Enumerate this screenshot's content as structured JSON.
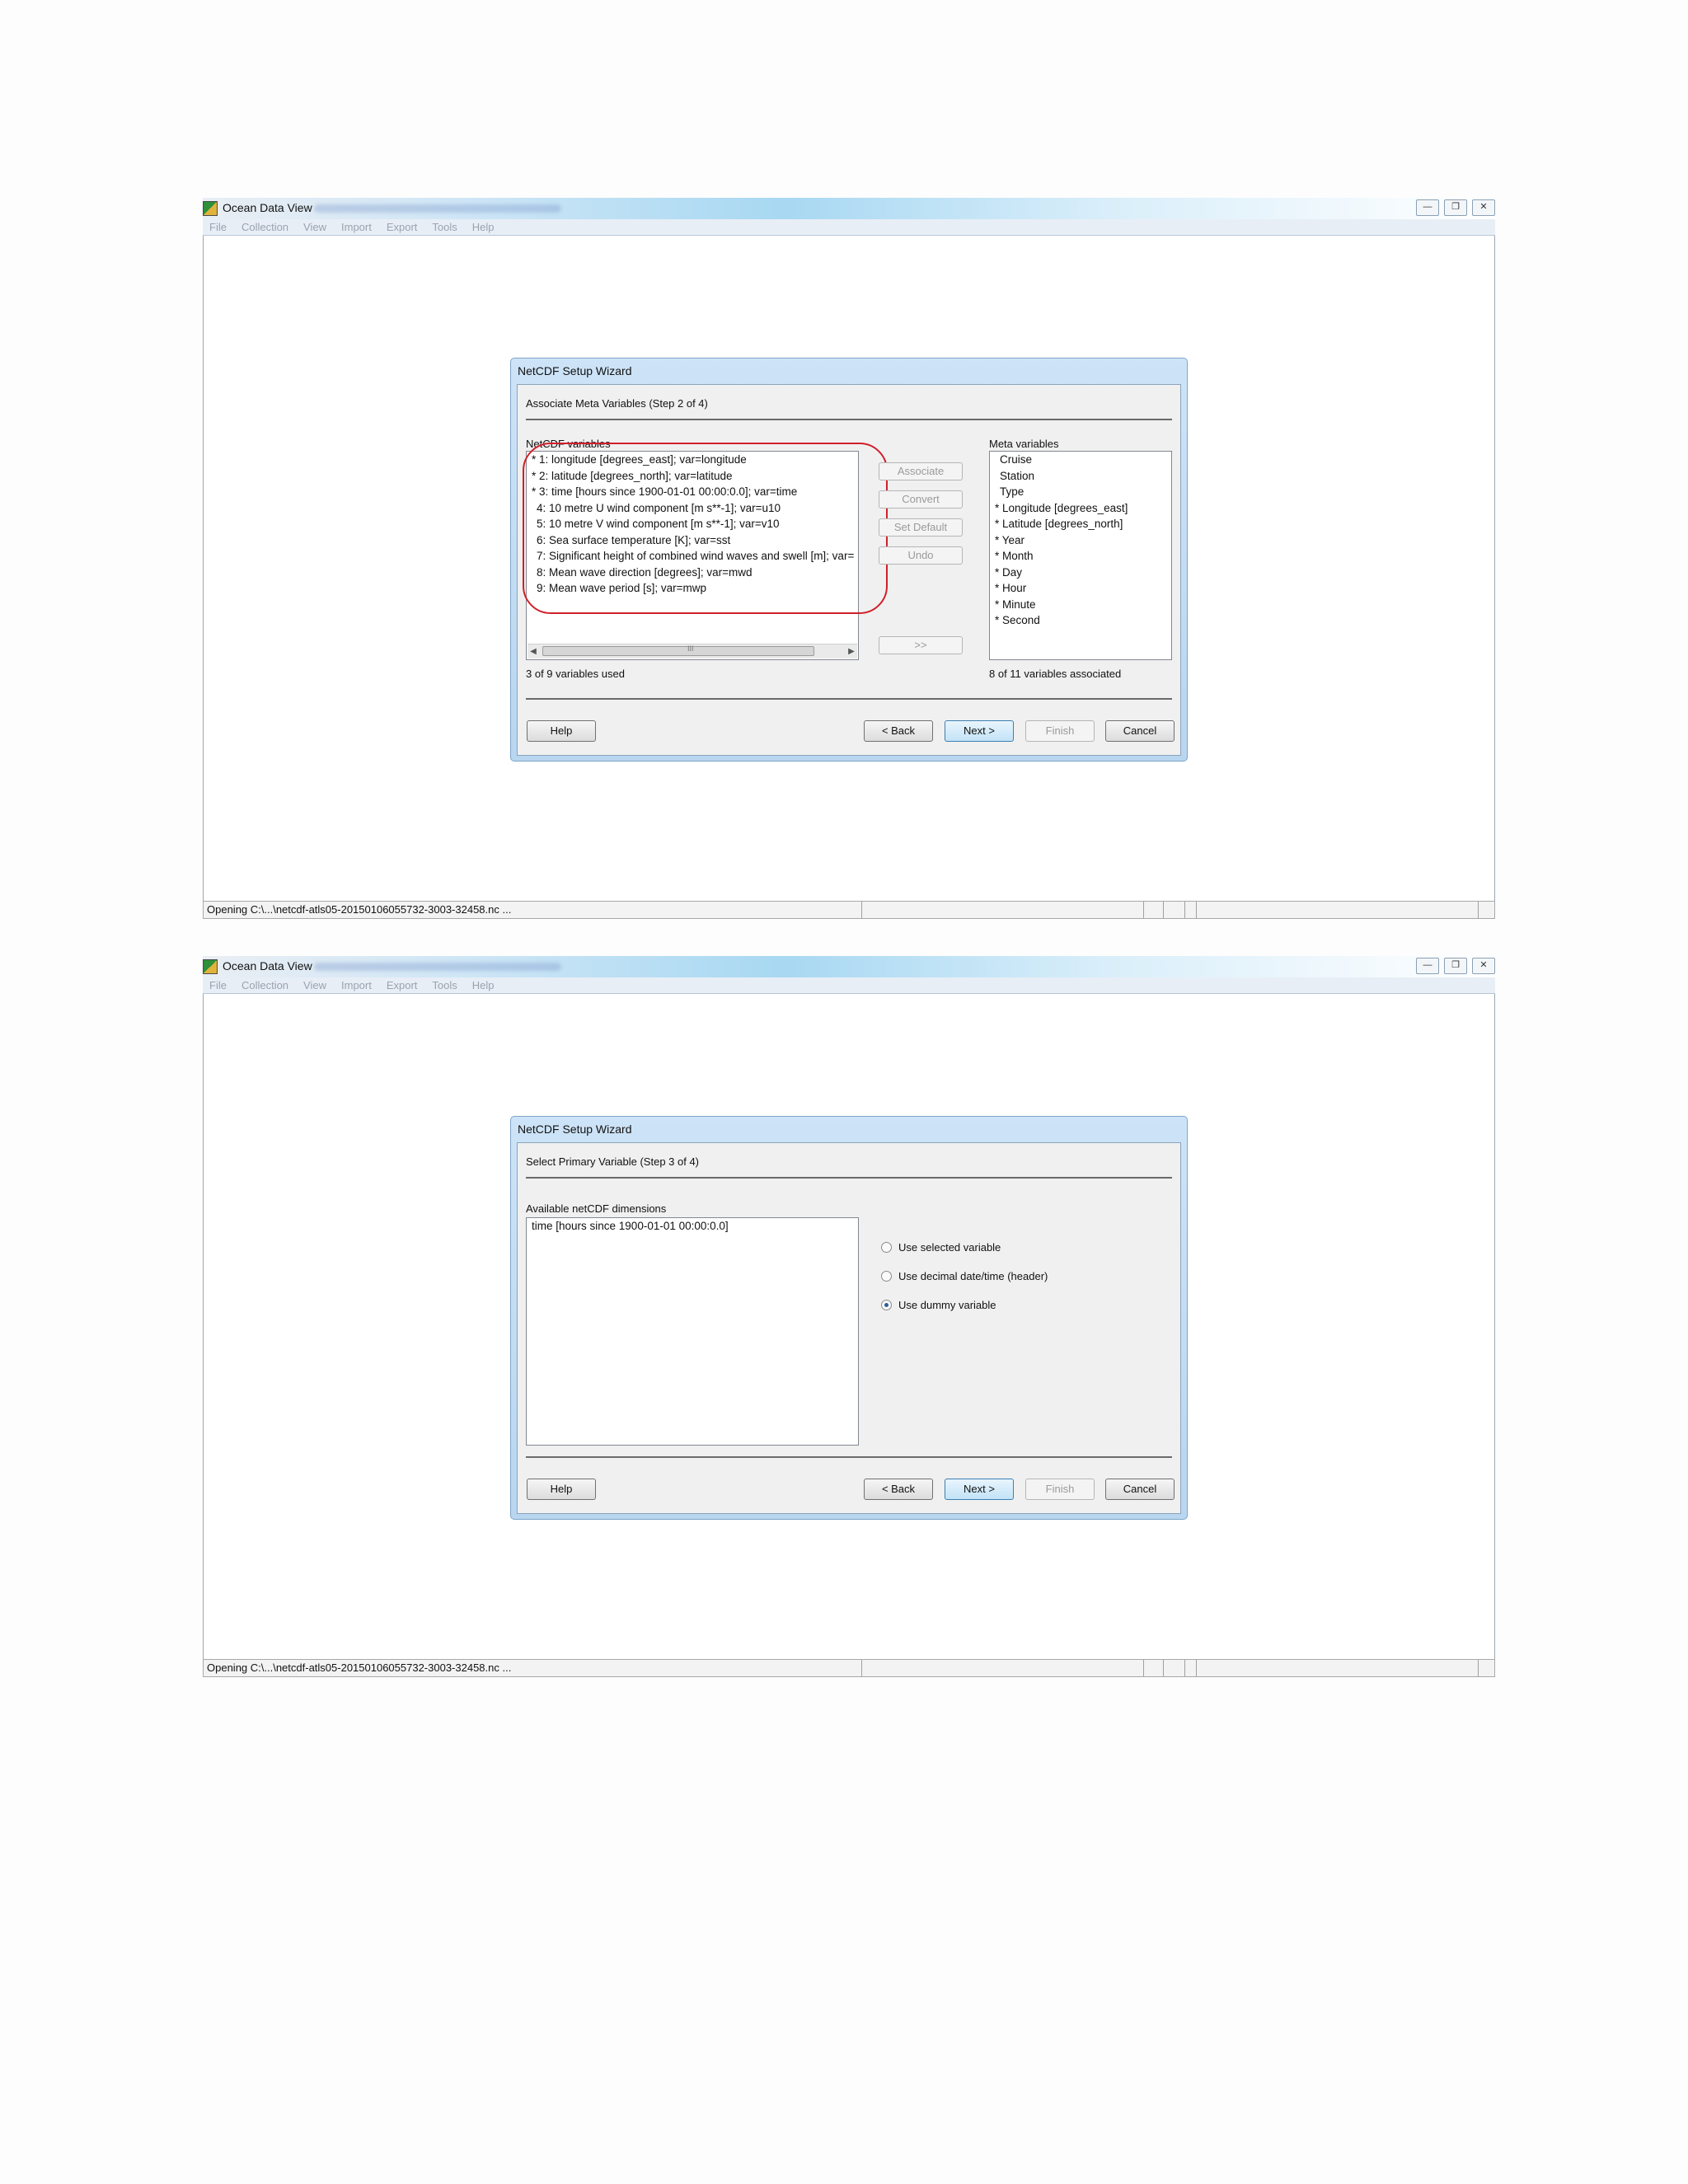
{
  "colors": {
    "highlight": "#d0202a",
    "accent": "#3c7fb1",
    "dialog_frame": "#b9d6f0"
  },
  "window_common": {
    "app_title": "Ocean Data View",
    "menu": [
      "File",
      "Collection",
      "View",
      "Import",
      "Export",
      "Tools",
      "Help"
    ],
    "status_text": "Opening C:\\...\\netcdf-atls05-20150106055732-3003-32458.nc ...",
    "icons": [
      "app-icon",
      "minimize-icon",
      "restore-icon",
      "close-icon"
    ]
  },
  "dialog1": {
    "title": "NetCDF Setup Wizard",
    "step": "Associate Meta Variables (Step 2 of 4)",
    "netcdf_label": "NetCDF variables",
    "netcdf_items": [
      "* 1: longitude [degrees_east]; var=longitude",
      "* 2: latitude [degrees_north]; var=latitude",
      "* 3: time [hours since 1900-01-01 00:00:0.0]; var=time",
      "4: 10 metre U wind component [m s**-1]; var=u10",
      "5: 10 metre V wind component [m s**-1]; var=v10",
      "6: Sea surface temperature [K]; var=sst",
      "7: Significant height of combined wind waves and swell [m]; var=",
      "8: Mean wave direction [degrees]; var=mwd",
      "9: Mean wave period [s]; var=mwp"
    ],
    "scroll_thumb_glyph": "III",
    "used_count": "3 of 9 variables used",
    "middle_buttons": [
      "Associate",
      "Convert",
      "Set Default",
      "Undo"
    ],
    "arrow_button": ">>",
    "meta_label": "Meta variables",
    "meta_items": [
      "Cruise",
      "Station",
      "Type",
      "* Longitude [degrees_east]",
      "* Latitude [degrees_north]",
      "* Year",
      "* Month",
      "* Day",
      "* Hour",
      "* Minute",
      "* Second"
    ],
    "assoc_count": "8 of 11 variables associated"
  },
  "dialog2": {
    "title": "NetCDF Setup Wizard",
    "step": "Select Primary Variable (Step 3 of 4)",
    "dims_label": "Available netCDF dimensions",
    "dims_items": [
      "time [hours since 1900-01-01 00:00:0.0]"
    ],
    "radios": [
      {
        "label": "Use selected variable",
        "checked": false
      },
      {
        "label": "Use decimal date/time (header)",
        "checked": false
      },
      {
        "label": "Use dummy variable",
        "checked": true
      }
    ]
  },
  "footer_buttons": {
    "help": "Help",
    "back": "< Back",
    "next": "Next >",
    "finish": "Finish",
    "cancel": "Cancel"
  }
}
